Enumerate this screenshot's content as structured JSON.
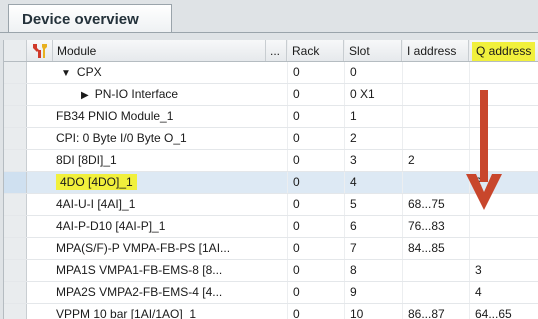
{
  "tab": {
    "title": "Device overview"
  },
  "columns": {
    "module": "Module",
    "dots": "...",
    "rack": "Rack",
    "slot": "Slot",
    "i_address": "I address",
    "q_address": "Q address"
  },
  "rows": [
    {
      "module": "CPX",
      "rack": "0",
      "slot": "0",
      "i": "",
      "q": ""
    },
    {
      "module": "PN-IO Interface",
      "rack": "0",
      "slot": "0 X1",
      "i": "",
      "q": ""
    },
    {
      "module": "FB34 PNIO Module_1",
      "rack": "0",
      "slot": "1",
      "i": "",
      "q": ""
    },
    {
      "module": "CPI: 0 Byte I/0 Byte O_1",
      "rack": "0",
      "slot": "2",
      "i": "",
      "q": ""
    },
    {
      "module": "8DI [8DI]_1",
      "rack": "0",
      "slot": "3",
      "i": "2",
      "q": ""
    },
    {
      "module": "4DO [4DO]_1",
      "rack": "0",
      "slot": "4",
      "i": "",
      "q": "2"
    },
    {
      "module": "4AI-U-I [4AI]_1",
      "rack": "0",
      "slot": "5",
      "i": "68...75",
      "q": ""
    },
    {
      "module": "4AI-P-D10 [4AI-P]_1",
      "rack": "0",
      "slot": "6",
      "i": "76...83",
      "q": ""
    },
    {
      "module": "MPA(S/F)-P VMPA-FB-PS [1AI...",
      "rack": "0",
      "slot": "7",
      "i": "84...85",
      "q": ""
    },
    {
      "module": "MPA1S VMPA1-FB-EMS-8 [8...",
      "rack": "0",
      "slot": "8",
      "i": "",
      "q": "3"
    },
    {
      "module": "MPA2S VMPA2-FB-EMS-4 [4...",
      "rack": "0",
      "slot": "9",
      "i": "",
      "q": "4"
    },
    {
      "module": "VPPM 10 bar [1AI/1AO]_1",
      "rack": "0",
      "slot": "10",
      "i": "86...87",
      "q": "64...65"
    }
  ],
  "highlight_color": "#f1f03c",
  "arrow_color": "#c8462c"
}
